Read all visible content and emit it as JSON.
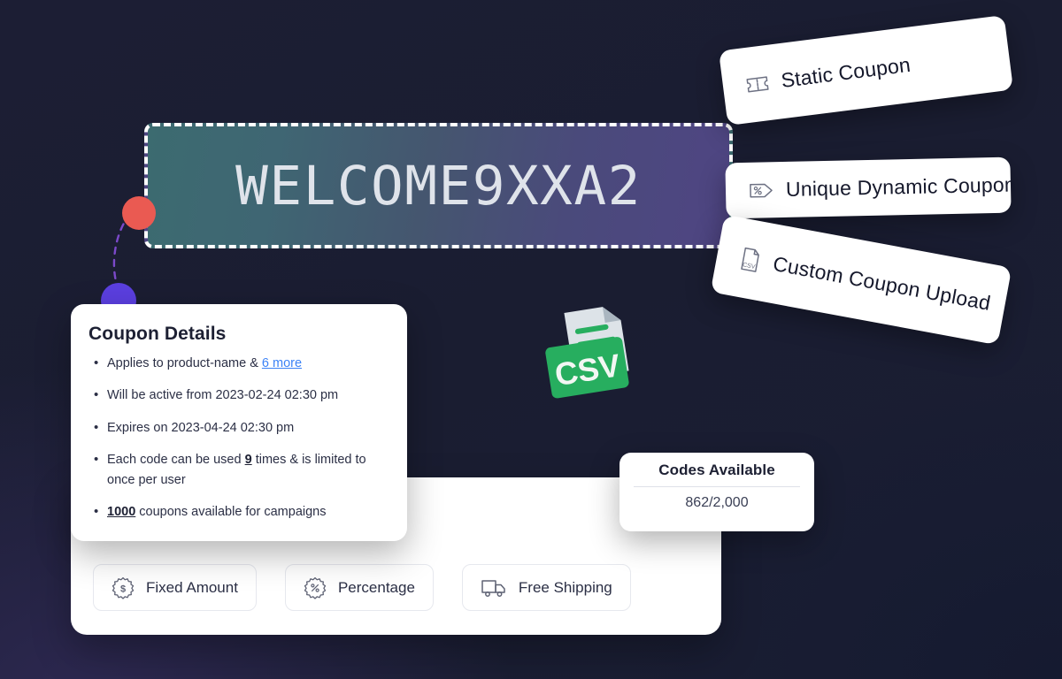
{
  "banner": {
    "coupon_code": "WELCOME9XXA2",
    "gradient_from": "#3c6b70",
    "gradient_to": "#4f4583",
    "border_style": "dashed-white"
  },
  "background": {
    "base_color": "#1b1e33",
    "accent_purple": "#2d2851"
  },
  "markers": {
    "top_dot_color": "#ea5a52",
    "bottom_dot_color": "#5b3fe0",
    "connector_style": "dashed-curve"
  },
  "coupon_type_cards": [
    {
      "label": "Static Coupon",
      "icon": "ticket-icon"
    },
    {
      "label": "Unique Dynamic Coupon",
      "icon": "percent-tag-icon"
    },
    {
      "label": "Custom Coupon Upload",
      "icon": "csv-file-icon"
    }
  ],
  "details": {
    "title": "Coupon Details",
    "items": [
      {
        "prefix": "Applies to product-name & ",
        "link": "6 more",
        "suffix": ""
      },
      {
        "prefix": "Will be active from 2023-02-24 02:30 pm",
        "link": "",
        "suffix": ""
      },
      {
        "prefix": "Expires on 2023-04-24 02:30 pm",
        "link": "",
        "suffix": ""
      },
      {
        "prefix": "Each code can be used ",
        "strong": "9",
        "suffix": " times & is limited to once per user"
      },
      {
        "prefix": "",
        "strong": "1000",
        "suffix": " coupons available for campaigns"
      }
    ],
    "link_color": "#3b82f6"
  },
  "codes_available": {
    "title": "Codes Available",
    "value": "862/2,000",
    "used": 862,
    "total": 2000
  },
  "discount_types": [
    {
      "label": "Fixed Amount",
      "icon": "dollar-badge-icon"
    },
    {
      "label": "Percentage",
      "icon": "percent-badge-icon"
    },
    {
      "label": "Free Shipping",
      "icon": "truck-icon"
    }
  ],
  "csv_graphic": {
    "label": "CSV",
    "accent_color": "#27ae5f",
    "paper_color": "#dde3e8"
  }
}
